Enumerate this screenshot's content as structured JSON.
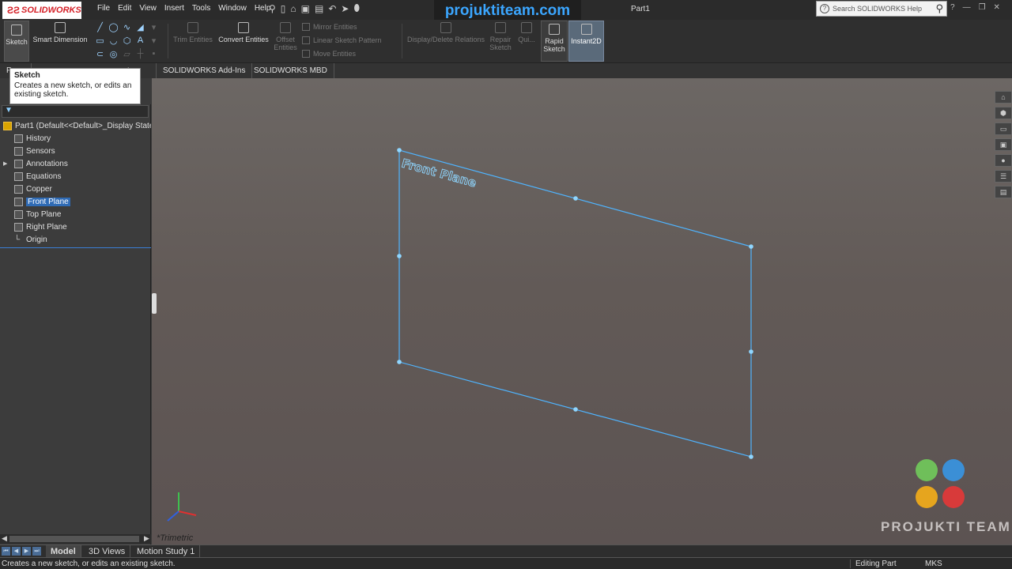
{
  "app": {
    "logo_text": "SOLIDWORKS",
    "document_title": "Part1",
    "watermark_banner": "projuktiteam.com",
    "search_placeholder": "Search SOLIDWORKS Help"
  },
  "menu": [
    "File",
    "Edit",
    "View",
    "Insert",
    "Tools",
    "Window",
    "Help"
  ],
  "command_manager": {
    "sketch": "Sketch",
    "smart_dimension": "Smart Dimension",
    "trim_entities": "Trim Entities",
    "convert_entities": "Convert Entities",
    "offset_entities": "Offset Entities",
    "mirror_entities": "Mirror Entities",
    "linear_sketch_pattern": "Linear Sketch Pattern",
    "move_entities": "Move Entities",
    "display_delete_relations": "Display/Delete Relations",
    "repair_sketch": "Repair Sketch",
    "quick": "Qui...",
    "rapid_sketch": "Rapid Sketch",
    "instant2d": "Instant2D"
  },
  "tabs": {
    "features": "F",
    "evaluate": "ert",
    "addins": "SOLIDWORKS Add-Ins",
    "mbd": "SOLIDWORKS MBD"
  },
  "tooltip": {
    "title": "Sketch",
    "text": "Creates a new sketch, or edits an existing sketch."
  },
  "tree": {
    "root": "Part1  (Default<<Default>_Display State",
    "items": [
      {
        "label": "History",
        "expandable": false
      },
      {
        "label": "Sensors",
        "expandable": false
      },
      {
        "label": "Annotations",
        "expandable": true
      },
      {
        "label": "Equations",
        "expandable": false
      },
      {
        "label": "Copper",
        "expandable": false
      },
      {
        "label": "Front Plane",
        "expandable": false,
        "selected": true
      },
      {
        "label": "Top Plane",
        "expandable": false
      },
      {
        "label": "Right Plane",
        "expandable": false
      },
      {
        "label": "Origin",
        "expandable": false
      }
    ]
  },
  "viewport": {
    "plane_label": "Front Plane",
    "view_orientation": "*Trimetric",
    "brand_text": "PROJUKTI TEAM"
  },
  "bottom_tabs": [
    "Model",
    "3D Views",
    "Motion Study 1"
  ],
  "status": {
    "message": "Creates a new sketch, or edits an existing sketch.",
    "mode": "Editing Part",
    "units": "MKS"
  },
  "colors": {
    "plane_outline": "#4fb4ff",
    "selection": "#2f6bb5",
    "brand_red": "#d51f26"
  }
}
